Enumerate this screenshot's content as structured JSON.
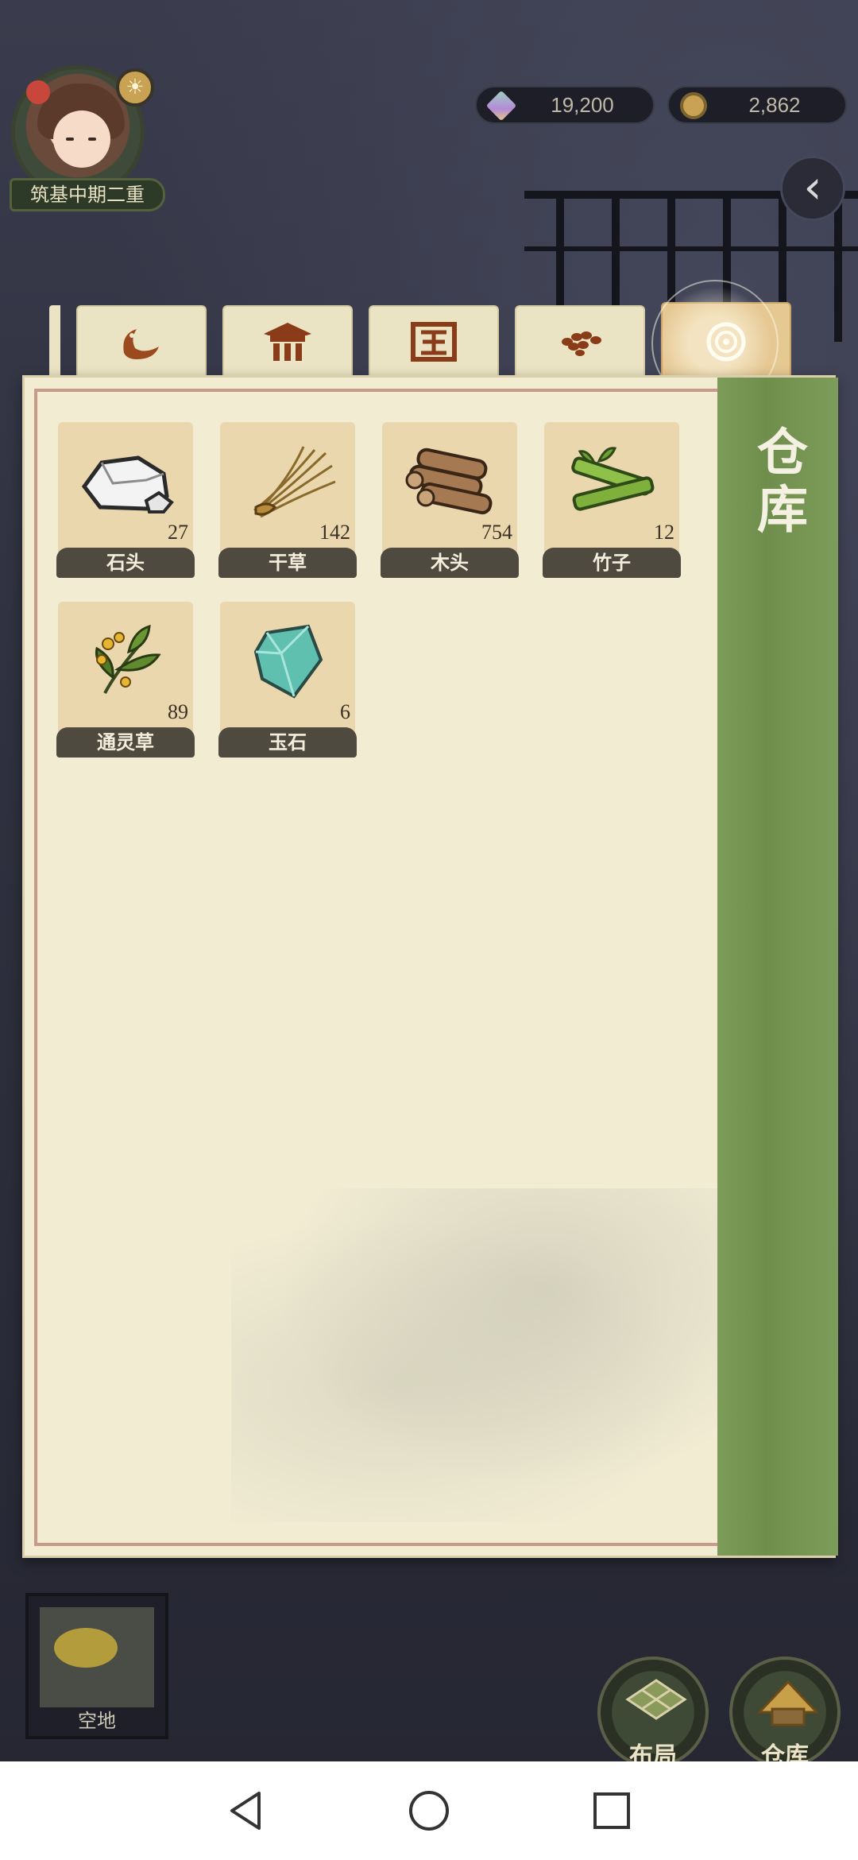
{
  "player": {
    "rank": "筑基中期二重",
    "badge_icon": "sun-icon"
  },
  "currencies": [
    {
      "icon": "spirit-crystal-icon",
      "value": "19,200"
    },
    {
      "icon": "coin-icon",
      "value": "2,862"
    }
  ],
  "tabs": [
    {
      "icon": "fish-icon",
      "active": false
    },
    {
      "icon": "building-icon",
      "active": false
    },
    {
      "icon": "field-icon",
      "active": false
    },
    {
      "icon": "seeds-icon",
      "active": false
    },
    {
      "icon": "storage-swirl-icon",
      "active": true
    }
  ],
  "panel": {
    "title": "仓库",
    "items": [
      {
        "name": "石头",
        "count": "27",
        "icon": "stone-icon"
      },
      {
        "name": "干草",
        "count": "142",
        "icon": "hay-icon"
      },
      {
        "name": "木头",
        "count": "754",
        "icon": "wood-icon"
      },
      {
        "name": "竹子",
        "count": "12",
        "icon": "bamboo-icon"
      },
      {
        "name": "通灵草",
        "count": "89",
        "icon": "spirit-herb-icon"
      },
      {
        "name": "玉石",
        "count": "6",
        "icon": "jade-icon"
      }
    ]
  },
  "bottom": {
    "empty_slot_label": "空地",
    "layout_label": "布局",
    "storage_label": "仓库"
  },
  "colors": {
    "panel_bg": "#f2ecd3",
    "side_strip": "#7d9b58",
    "tab_bg": "#ebe4c4",
    "active_tab": "#e6c893",
    "item_bg": "#ead7ae"
  }
}
